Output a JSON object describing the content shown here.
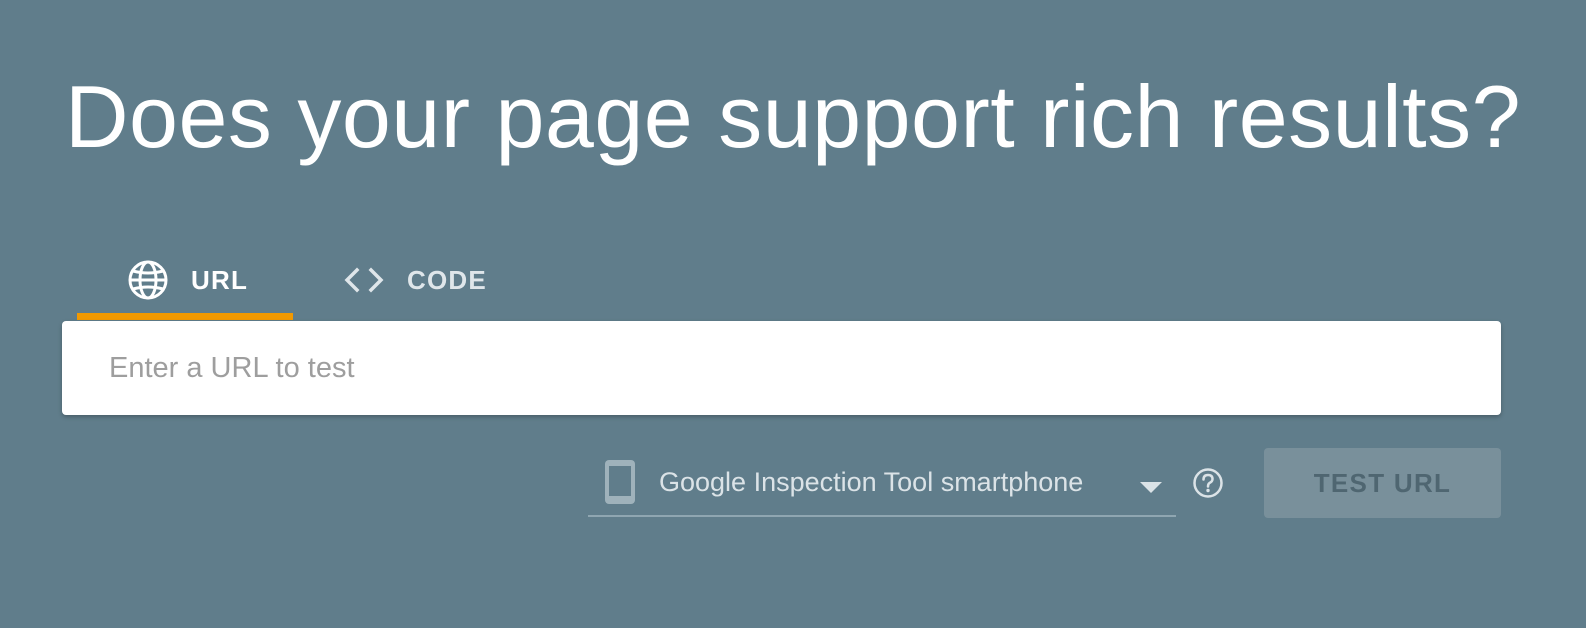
{
  "header": {
    "title": "Does your page support rich results?"
  },
  "tabs": [
    {
      "label": "URL",
      "icon": "globe-icon",
      "active": true
    },
    {
      "label": "CODE",
      "icon": "code-icon",
      "active": false
    }
  ],
  "url_input": {
    "placeholder": "Enter a URL to test",
    "value": ""
  },
  "user_agent": {
    "selected": "Google Inspection Tool smartphone",
    "icon": "smartphone-icon"
  },
  "help": {
    "icon": "help-icon"
  },
  "test_button": {
    "label": "TEST URL",
    "disabled": true
  },
  "colors": {
    "background": "#607d8b",
    "active_tab_indicator": "#f29900",
    "button_disabled_bg": "#79909b"
  }
}
